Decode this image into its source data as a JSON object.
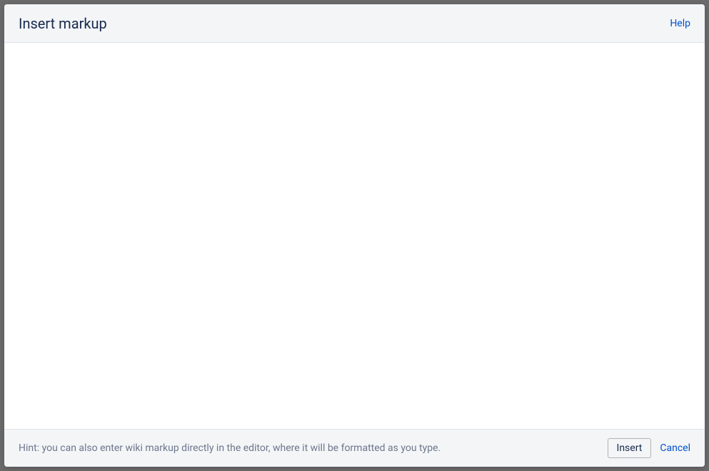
{
  "dialog": {
    "title": "Insert markup",
    "help_label": "Help",
    "hint_text": "Hint: you can also enter wiki markup directly in the editor, where it will be formatted as you type.",
    "insert_label": "Insert",
    "cancel_label": "Cancel",
    "textarea_value": ""
  }
}
